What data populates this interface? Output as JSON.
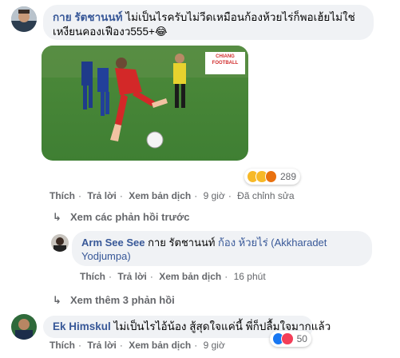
{
  "comment1": {
    "author": "กาย รัตชานนท์",
    "text": "ไม่เป็นไรครับไม่วีดเหมือนก้องห้วยไร่ก็พอเฮ้ยไม่ใช่เหงียนคองเฟืองว555+",
    "emoji": "😂",
    "reactions": {
      "count": "289",
      "icons": [
        "haha",
        "wow",
        "angry"
      ]
    },
    "actions": {
      "like": "Thích",
      "reply": "Trả lời",
      "translate": "Xem bản dịch",
      "time": "9 giờ",
      "edited": "Đã chỉnh sửa"
    },
    "photo_logo": "CHIANG FOOTBALL"
  },
  "prev_replies": "Xem các phản hồi trước",
  "reply1": {
    "author": "Arm See See",
    "mention_plain": "กาย รัตชานนท์",
    "mention_link": "ก้อง ห้วยไร่ (Akkharadet Yodjumpa)",
    "actions": {
      "like": "Thích",
      "reply": "Trả lời",
      "translate": "Xem bản dịch",
      "time": "16 phút"
    }
  },
  "more_replies": "Xem thêm 3 phản hồi",
  "comment2": {
    "author": "Ek Himskul",
    "text": "ไม่เป็นไรไอ้น้อง สู้สุดใจแค่นี้ พี่ก็ปลื้มใจมากแล้ว",
    "reactions": {
      "count": "50",
      "icons": [
        "like",
        "love"
      ]
    },
    "actions": {
      "like": "Thích",
      "reply": "Trả lời",
      "translate": "Xem bản dịch",
      "time": "9 giờ"
    }
  }
}
